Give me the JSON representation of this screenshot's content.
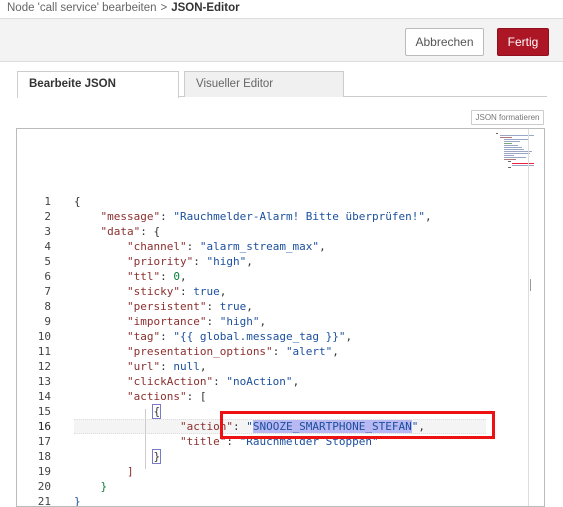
{
  "breadcrumb": {
    "parent": "Node 'call service' bearbeiten",
    "separator": ">",
    "current": "JSON-Editor"
  },
  "toolbar": {
    "cancel_label": "Abbrechen",
    "done_label": "Fertig"
  },
  "tabs": [
    {
      "label": "Bearbeite JSON",
      "active": true
    },
    {
      "label": "Visueller Editor",
      "active": false
    }
  ],
  "format_button_label": "JSON formatieren",
  "editor": {
    "active_line": 16,
    "selected_text": "SNOOZE_SMARTPHONE_STEFAN",
    "line_numbers": [
      "1",
      "2",
      "3",
      "4",
      "5",
      "6",
      "7",
      "8",
      "9",
      "10",
      "11",
      "12",
      "13",
      "14",
      "15",
      "16",
      "17",
      "18",
      "19",
      "20",
      "21"
    ],
    "lines": {
      "l1": "{",
      "l2_key": "\"message\"",
      "l2_val": "\"Rauchmelder-Alarm! Bitte überprüfen!\"",
      "l3_key": "\"data\"",
      "l3_rest": "{",
      "l4_key": "\"channel\"",
      "l4_val": "\"alarm_stream_max\"",
      "l5_key": "\"priority\"",
      "l5_val": "\"high\"",
      "l6_key": "\"ttl\"",
      "l6_val": "0",
      "l7_key": "\"sticky\"",
      "l7_val": "true",
      "l8_key": "\"persistent\"",
      "l8_val": "true",
      "l9_key": "\"importance\"",
      "l9_val": "\"high\"",
      "l10_key": "\"tag\"",
      "l10_val": "\"{{ global.message_tag }}\"",
      "l11_key": "\"presentation_options\"",
      "l11_val": "\"alert\"",
      "l12_key": "\"url\"",
      "l12_val": "null",
      "l13_key": "\"clickAction\"",
      "l13_val": "\"noAction\"",
      "l14_key": "\"actions\"",
      "l14_rest": "[",
      "l15": "{",
      "l16_key": "\"action\"",
      "l16_quote_open": "\"",
      "l16_selected": "SNOOZE_SMARTPHONE_STEFAN",
      "l16_quote_close": "\"",
      "l17_key": "\"title\"",
      "l17_val": "\"Rauchmelder Stoppen\"",
      "l18": "}",
      "l19": "]",
      "l20": "}",
      "l21": "}"
    }
  },
  "colors": {
    "accent": "#ad1625",
    "highlight_box": "#ee1111",
    "selection": "#b8b8f2",
    "key": "#8b2f2f",
    "string": "#1b4f9e",
    "number": "#0a7a3a"
  }
}
